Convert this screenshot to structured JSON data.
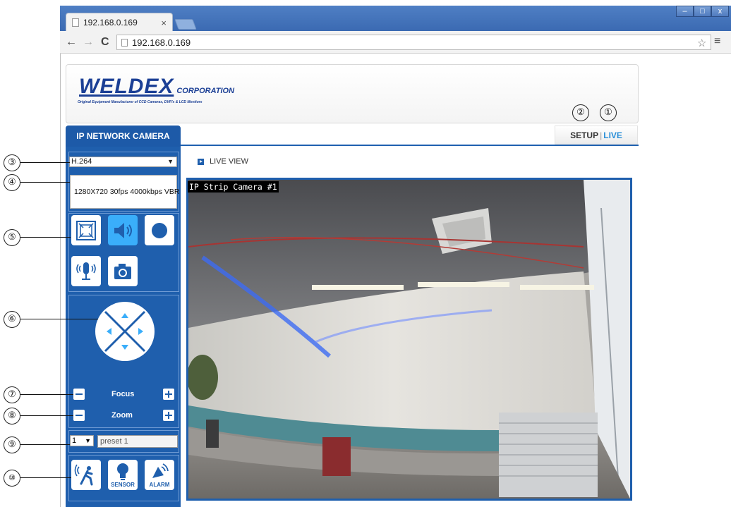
{
  "browser": {
    "tab_title": "192.168.0.169",
    "tab_close": "×",
    "url": "192.168.0.169",
    "back": "←",
    "forward": "→",
    "reload": "C",
    "star": "☆",
    "menu": "≡",
    "win_min": "–",
    "win_max": "□",
    "win_close": "x"
  },
  "header": {
    "logo": "WELDEX",
    "logo_corp": "CORPORATION",
    "logo_tagline": "Original Equipment Manufacturer of CCD Cameras, DVR's & LCD Monitors"
  },
  "nav": {
    "setup": "SETUP",
    "separator": "|",
    "live": "LIVE"
  },
  "sidebar": {
    "title": "IP NETWORK CAMERA",
    "codec": "H.264",
    "stream_info": "1280X720 30fps 4000kbps VBR",
    "focus_label": "Focus",
    "zoom_label": "Zoom",
    "preset_number": "1",
    "preset_name": "preset 1",
    "sensor_label": "SENSOR",
    "alarm_label": "ALARM"
  },
  "main": {
    "section_title": "LIVE VIEW",
    "camera_label": "IP Strip Camera #1"
  },
  "callouts": [
    "①",
    "②",
    "③",
    "④",
    "⑤",
    "⑥",
    "⑦",
    "⑧",
    "⑨",
    "⑩"
  ],
  "colors": {
    "brand_blue": "#1f5fad",
    "active_blue": "#3aaefa",
    "live_link": "#2a8fd8"
  },
  "icons": [
    "fullscreen-icon",
    "speaker-icon",
    "record-icon",
    "microphone-icon",
    "camera-icon",
    "motion-icon",
    "sensor-icon",
    "alarm-icon"
  ]
}
